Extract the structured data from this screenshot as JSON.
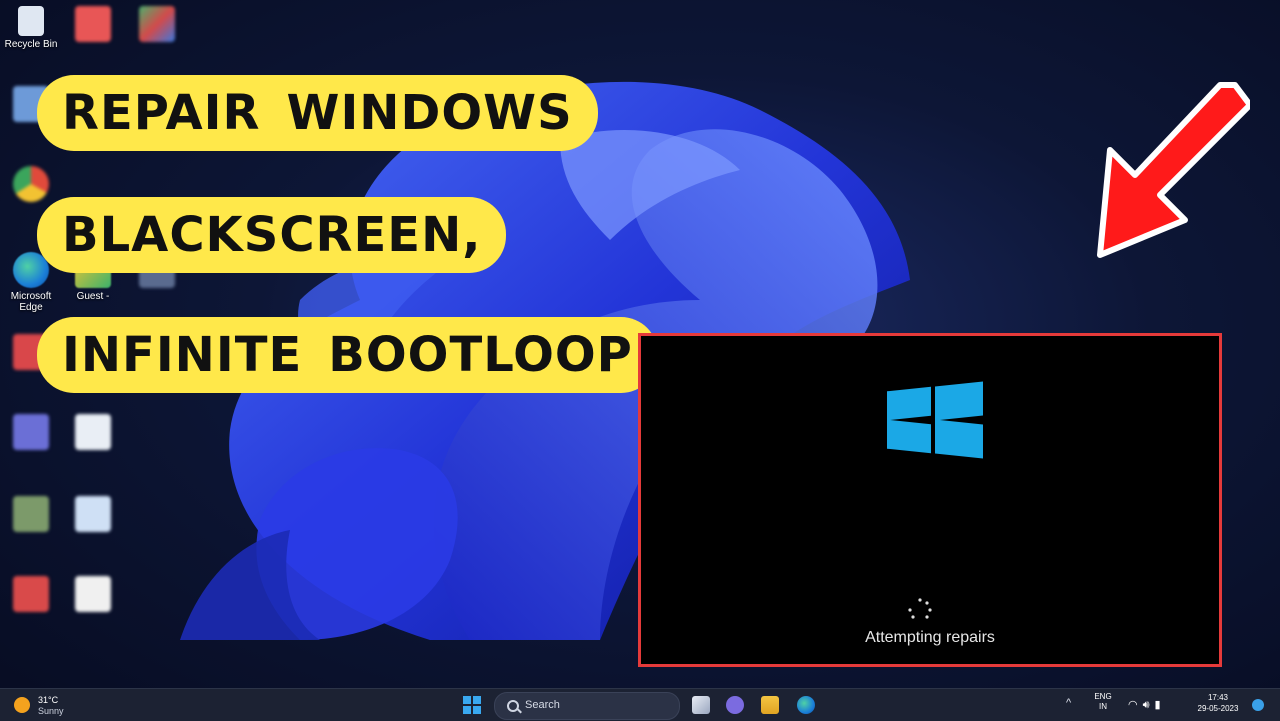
{
  "desktop": {
    "icons": [
      {
        "label": "Recycle Bin",
        "icon": "recycle-bin-icon"
      },
      {
        "label": "Microsoft Edge",
        "icon": "edge-icon"
      },
      {
        "label": "Guest -",
        "icon": "shortcut-icon"
      }
    ]
  },
  "title": {
    "line1_a": "REPAIR",
    "line1_b": "WINDOWS",
    "line2": "BLACKSCREEN,",
    "line3_a": "INFINITE",
    "line3_b": "BOOTLOOP"
  },
  "inset": {
    "status_text": "Attempting repairs",
    "logo": "windows-logo-icon",
    "logo_color": "#1ba8e6",
    "border_color": "#e53a3a"
  },
  "arrow_color": "#ff1a1a",
  "taskbar": {
    "weather_temp": "31°C",
    "weather_condition": "Sunny",
    "search_placeholder": "Search",
    "tray_chevron": "^",
    "language_line1": "ENG",
    "language_line2": "IN",
    "time": "17:43",
    "date": "29-05-2023"
  }
}
